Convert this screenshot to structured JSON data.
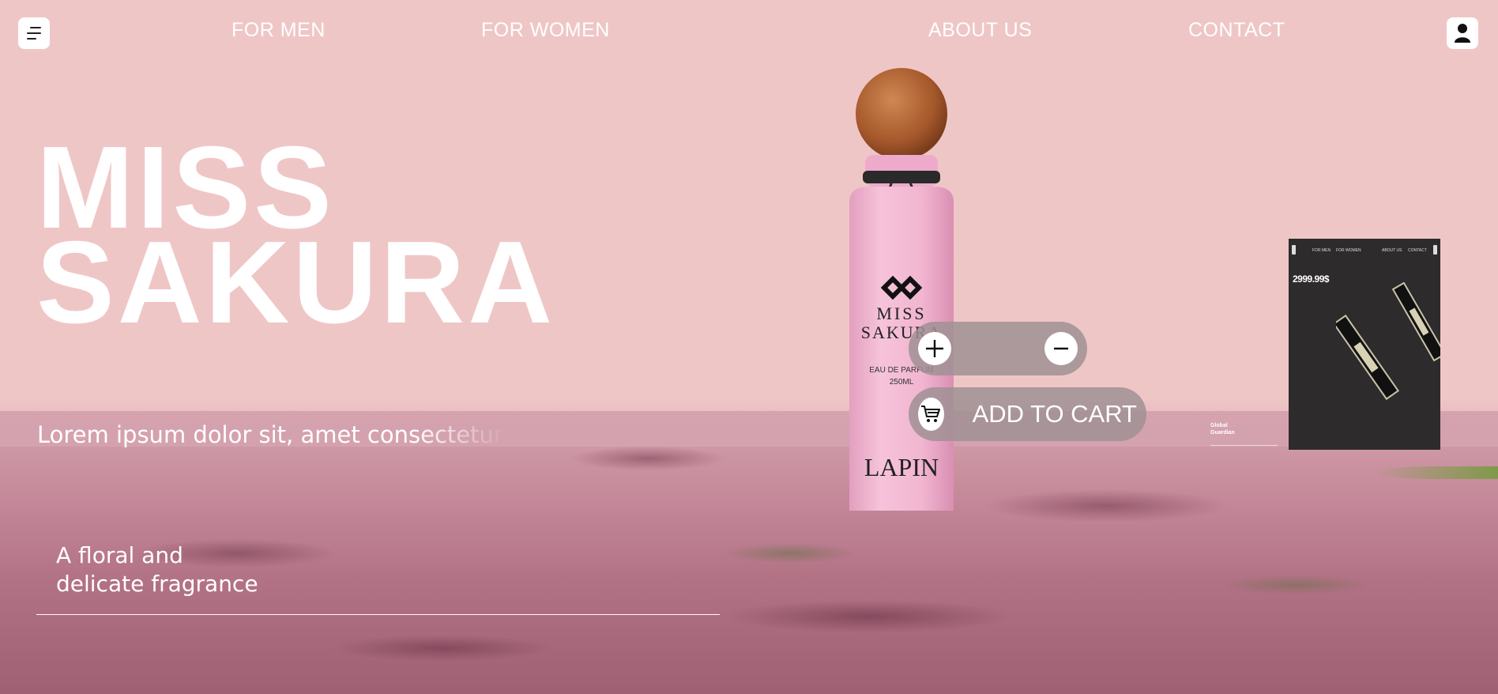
{
  "nav": {
    "links": [
      "FOR MEN",
      "FOR WOMEN",
      "ABOUT US",
      "CONTACT"
    ],
    "menu_icon": "menu-icon",
    "user_icon": "user-icon"
  },
  "hero": {
    "title_line1": "MISS",
    "title_line2": "SAKURA",
    "description": "Lorem ipsum dolor sit, amet consectetur",
    "tagline_line1": "A floral and",
    "tagline_line2": "delicate fragrance"
  },
  "product": {
    "brand_line1": "MISS",
    "brand_line2": "SAKURA",
    "type": "EAU DE PARFUM",
    "volume": "250ML",
    "maker": "LAPIN"
  },
  "controls": {
    "plus_icon": "plus-icon",
    "minus_icon": "minus-icon",
    "cart_icon": "cart-icon",
    "add_to_cart": "ADD TO CART"
  },
  "preview": {
    "price": "2999.99$",
    "nav_links": [
      "FOR MEN",
      "FOR WOMEN",
      "ABOUT US",
      "CONTACT"
    ],
    "caption_line1": "Global",
    "caption_line2": "Guardian"
  },
  "colors": {
    "background": "#efc6c6",
    "bottle": "#f2b6d0",
    "cap": "#b5693a",
    "pill": "#a09194",
    "preview_bg": "#2d2b2c"
  }
}
